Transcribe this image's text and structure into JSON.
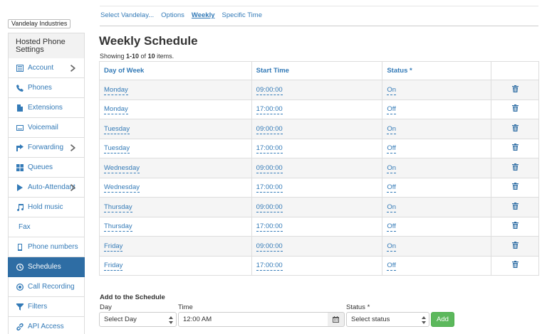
{
  "company": "Vandelay Industries",
  "sidebar": {
    "heading": "Hosted Phone Settings",
    "items": [
      {
        "label": "Account",
        "icon": "list-icon",
        "chevron": true
      },
      {
        "label": "Phones",
        "icon": "phone-icon",
        "chevron": false
      },
      {
        "label": "Extensions",
        "icon": "document-icon",
        "chevron": false
      },
      {
        "label": "Voicemail",
        "icon": "voicemail-icon",
        "chevron": false
      },
      {
        "label": "Forwarding",
        "icon": "forward-icon",
        "chevron": true
      },
      {
        "label": "Queues",
        "icon": "grid-icon",
        "chevron": false
      },
      {
        "label": "Auto-Attendant",
        "icon": "play-icon",
        "chevron": true
      },
      {
        "label": "Hold music",
        "icon": "music-icon",
        "chevron": false
      },
      {
        "label": "Fax",
        "icon": "",
        "chevron": false
      },
      {
        "label": "Phone numbers",
        "icon": "mobile-icon",
        "chevron": false
      },
      {
        "label": "Schedules",
        "icon": "clock-icon",
        "chevron": false,
        "active": true
      },
      {
        "label": "Call Recording",
        "icon": "record-icon",
        "chevron": false
      },
      {
        "label": "Filters",
        "icon": "filter-icon",
        "chevron": false
      },
      {
        "label": "API Access",
        "icon": "link-icon",
        "chevron": false
      }
    ]
  },
  "topnav": {
    "items": [
      "Select Vandelay...",
      "Options",
      "Weekly",
      "Specific Time"
    ],
    "active": "Weekly"
  },
  "page": {
    "title": "Weekly Schedule",
    "showing_prefix": "Showing ",
    "showing_range": "1-10",
    "showing_of": " of ",
    "showing_total": "10",
    "showing_suffix": " items."
  },
  "table": {
    "headers": [
      "Day of Week",
      "Start Time",
      "Status *",
      ""
    ],
    "rows": [
      [
        "Monday",
        "09:00:00",
        "On"
      ],
      [
        "Monday",
        "17:00:00",
        "Off"
      ],
      [
        "Tuesday",
        "09:00:00",
        "On"
      ],
      [
        "Tuesday",
        "17:00:00",
        "Off"
      ],
      [
        "Wednesday",
        "09:00:00",
        "On"
      ],
      [
        "Wednesday",
        "17:00:00",
        "Off"
      ],
      [
        "Thursday",
        "09:00:00",
        "On"
      ],
      [
        "Thursday",
        "17:00:00",
        "Off"
      ],
      [
        "Friday",
        "09:00:00",
        "On"
      ],
      [
        "Friday",
        "17:00:00",
        "Off"
      ]
    ]
  },
  "add_form": {
    "title": "Add to the Schedule",
    "day_label": "Day",
    "day_value": "Select Day",
    "time_label": "Time",
    "time_value": "12:00 AM",
    "status_label": "Status *",
    "status_value": "Select status",
    "add_label": "Add"
  },
  "colors": {
    "link": "#337ab7",
    "active_bg": "#2e6da4",
    "add_button": "#5cb85c"
  }
}
